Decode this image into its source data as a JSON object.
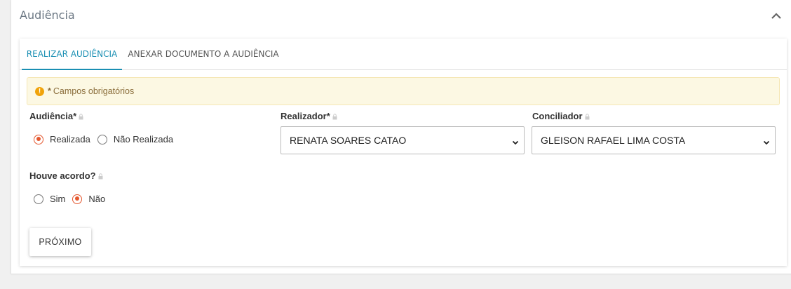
{
  "panel": {
    "title": "Audiência"
  },
  "tabs": [
    {
      "label": "REALIZAR AUDIÊNCIA",
      "active": true
    },
    {
      "label": "ANEXAR DOCUMENTO A AUDIÊNCIA",
      "active": false
    }
  ],
  "alert": {
    "marker": "*",
    "text": "Campos obrigatórios",
    "icon": "exclamation-circle-icon"
  },
  "form": {
    "audiencia": {
      "label": "Audiência*",
      "options": [
        "Realizada",
        "Não Realizada"
      ],
      "selected": "Realizada"
    },
    "realizador": {
      "label": "Realizador*",
      "value": "RENATA SOARES CATAO"
    },
    "conciliador": {
      "label": "Conciliador",
      "value": "GLEISON RAFAEL LIMA COSTA"
    },
    "acordo": {
      "label": "Houve acordo?",
      "options": [
        "Sim",
        "Não"
      ],
      "selected": "Não"
    }
  },
  "actions": {
    "next_label": "PRÓXIMO"
  },
  "colors": {
    "accent": "#1a8fb3",
    "radio_checked": "#e4572e",
    "alert_bg": "#fcf8e3",
    "alert_text": "#8a6d3b"
  }
}
